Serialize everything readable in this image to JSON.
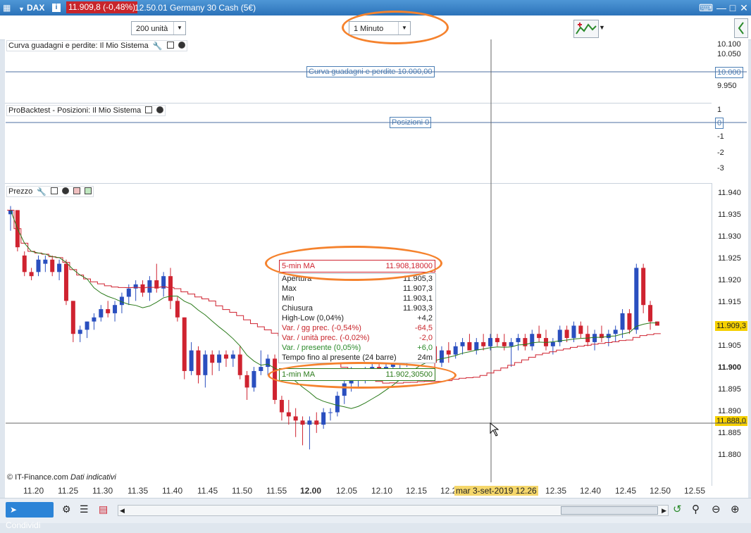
{
  "titlebar": {
    "symbol": "DAX",
    "price_change": "11.909,8 (-0,48%)",
    "time_instrument": "12.50.01 Germany 30 Cash (5€)"
  },
  "toolbar": {
    "units_select": "200 unità",
    "timeframe_select": "1 Minuto"
  },
  "panels": {
    "equity": {
      "title": "Curva guadagni e perdite: Il Mio Sistema",
      "value_label": "Curva guadagni e perdite   10.000,00",
      "axis": [
        "10.100",
        "10.050",
        "9.950"
      ],
      "axis_current": "10.000"
    },
    "positions": {
      "title": "ProBacktest - Posizioni: Il Mio Sistema",
      "value_label": "Posizioni   0",
      "axis": [
        "1",
        "-1",
        "-2",
        "-3"
      ],
      "axis_current": "0"
    },
    "price": {
      "title": "Prezzo",
      "axis": [
        "11.940",
        "11.935",
        "11.930",
        "11.925",
        "11.920",
        "11.915",
        "11.905",
        "11.900",
        "11.895",
        "11.890",
        "11.885",
        "11.880"
      ],
      "last_price": "11.909,3",
      "cursor_price": "11.888,0"
    }
  },
  "info_box": {
    "ma5_label": "5-min MA",
    "ma5_value": "11.908,18000",
    "rows": [
      {
        "label": "Apertura",
        "value": "11.905,3",
        "color": "#222222"
      },
      {
        "label": "Max",
        "value": "11.907,3",
        "color": "#222222"
      },
      {
        "label": "Min",
        "value": "11.903,1",
        "color": "#222222"
      },
      {
        "label": "Chiusura",
        "value": "11.903,3",
        "color": "#222222"
      },
      {
        "label": "High-Low (0,04%)",
        "value": "+4,2",
        "color": "#222222"
      },
      {
        "label": "Var. / gg prec. (-0,54%)",
        "value": "-64,5",
        "color": "#c8252b"
      },
      {
        "label": "Var. / unità prec. (-0,02%)",
        "value": "-2,0",
        "color": "#c8252b"
      },
      {
        "label": "Var. / presente (0,05%)",
        "value": "+6,0",
        "color": "#2a8a2a"
      },
      {
        "label": "Tempo fino al presente (24 barre)",
        "value": "24m",
        "color": "#222222"
      }
    ],
    "ma1_label": "1-min MA",
    "ma1_value": "11.902,30500"
  },
  "x_axis": [
    "11.20",
    "11.25",
    "11.30",
    "11.35",
    "11.40",
    "11.45",
    "11.50",
    "11.55",
    "12.00",
    "12.05",
    "12.10",
    "12.15",
    "12.2",
    "12.35",
    "12.40",
    "12.45",
    "12.50",
    "12.55"
  ],
  "cursor_time": "mar 3-set-2019 12.26",
  "credits": {
    "source": "© IT-Finance.com",
    "note": "Dati indicativi"
  },
  "bottom": {
    "share_label": "Condividi"
  },
  "colors": {
    "up": "#2a4fbf",
    "down": "#cf2330",
    "ma5": "#cf2330",
    "ma1": "#2a7a1a",
    "highlight": "#f5822d"
  },
  "chart_data": {
    "type": "candlestick",
    "x": [
      "11.17",
      "11.18",
      "11.19",
      "11.20",
      "11.21",
      "11.22",
      "11.23",
      "11.24",
      "11.25",
      "11.26",
      "11.27",
      "11.28",
      "11.29",
      "11.30",
      "11.31",
      "11.32",
      "11.33",
      "11.34",
      "11.35",
      "11.36",
      "11.37",
      "11.38",
      "11.39",
      "11.40",
      "11.41",
      "11.42",
      "11.43",
      "11.44",
      "11.45",
      "11.46",
      "11.47",
      "11.48",
      "11.49",
      "11.50",
      "11.51",
      "11.52",
      "11.53",
      "11.54",
      "11.55",
      "11.56",
      "11.57",
      "11.58",
      "11.59",
      "12.00",
      "12.01",
      "12.02",
      "12.03",
      "12.04",
      "12.05",
      "12.06",
      "12.07",
      "12.08",
      "12.09",
      "12.10",
      "12.11",
      "12.12",
      "12.13",
      "12.14",
      "12.15",
      "12.16",
      "12.17",
      "12.18",
      "12.19",
      "12.20",
      "12.21",
      "12.22",
      "12.23",
      "12.24",
      "12.25",
      "12.26",
      "12.27",
      "12.28",
      "12.29",
      "12.30",
      "12.31",
      "12.32",
      "12.33",
      "12.34",
      "12.35",
      "12.36",
      "12.37",
      "12.38",
      "12.39",
      "12.40",
      "12.41",
      "12.42",
      "12.43",
      "12.44",
      "12.45",
      "12.46",
      "12.47",
      "12.48",
      "12.49",
      "12.50"
    ],
    "ohlc": [
      [
        11936,
        11938,
        11932,
        11937
      ],
      [
        11937,
        11937,
        11927,
        11928
      ],
      [
        11926,
        11927,
        11921,
        11922
      ],
      [
        11922,
        11923,
        11920,
        11921
      ],
      [
        11922,
        11926,
        11921,
        11925
      ],
      [
        11924,
        11926,
        11922,
        11925
      ],
      [
        11925,
        11926,
        11921,
        11922
      ],
      [
        11922,
        11925,
        11920,
        11924
      ],
      [
        11924,
        11925,
        11914,
        11915
      ],
      [
        11915,
        11915,
        11905,
        11907
      ],
      [
        11907,
        11909,
        11905,
        11908
      ],
      [
        11908,
        11910,
        11906,
        11910
      ],
      [
        11910,
        11912,
        11908,
        11911
      ],
      [
        11911,
        11914,
        11910,
        11913
      ],
      [
        11913,
        11915,
        11911,
        11912
      ],
      [
        11912,
        11915,
        11910,
        11914
      ],
      [
        11914,
        11917,
        11912,
        11916
      ],
      [
        11916,
        11919,
        11914,
        11918
      ],
      [
        11918,
        11920,
        11915,
        11919
      ],
      [
        11919,
        11920,
        11916,
        11917
      ],
      [
        11917,
        11921,
        11915,
        11920
      ],
      [
        11920,
        11924,
        11917,
        11918
      ],
      [
        11918,
        11922,
        11916,
        11921
      ],
      [
        11921,
        11923,
        11913,
        11915
      ],
      [
        11915,
        11916,
        11910,
        11911
      ],
      [
        11911,
        11911,
        11896,
        11898
      ],
      [
        11898,
        11905,
        11897,
        11903
      ],
      [
        11903,
        11904,
        11895,
        11897
      ],
      [
        11897,
        11903,
        11894,
        11902
      ],
      [
        11902,
        11903,
        11897,
        11900
      ],
      [
        11900,
        11903,
        11898,
        11902
      ],
      [
        11902,
        11903,
        11899,
        11901
      ],
      [
        11901,
        11903,
        11899,
        11902
      ],
      [
        11902,
        11904,
        11896,
        11897
      ],
      [
        11897,
        11898,
        11891,
        11894
      ],
      [
        11894,
        11899,
        11893,
        11898
      ],
      [
        11898,
        11903,
        11897,
        11899
      ],
      [
        11899,
        11902,
        11897,
        11901
      ],
      [
        11901,
        11902,
        11890,
        11891
      ],
      [
        11891,
        11892,
        11886,
        11888
      ],
      [
        11888,
        11891,
        11885,
        11887
      ],
      [
        11887,
        11889,
        11882,
        11886
      ],
      [
        11886,
        11887,
        11880,
        11885
      ],
      [
        11885,
        11887,
        11879,
        11886
      ],
      [
        11886,
        11888,
        11883,
        11885
      ],
      [
        11885,
        11889,
        11884,
        11888
      ],
      [
        11888,
        11889,
        11886,
        11888
      ],
      [
        11888,
        11893,
        11887,
        11892
      ],
      [
        11892,
        11896,
        11890,
        11895
      ],
      [
        11895,
        11899,
        11893,
        11896
      ],
      [
        11896,
        11898,
        11894,
        11897
      ],
      [
        11897,
        11899,
        11895,
        11898
      ],
      [
        11898,
        11900,
        11896,
        11899
      ],
      [
        11899,
        11901,
        11897,
        11898
      ],
      [
        11898,
        11900,
        11896,
        11899
      ],
      [
        11899,
        11901,
        11897,
        11900
      ],
      [
        11900,
        11902,
        11898,
        11901
      ],
      [
        11901,
        11903,
        11899,
        11902
      ],
      [
        11902,
        11904,
        11900,
        11903
      ],
      [
        11903,
        11906,
        11901,
        11905
      ],
      [
        11905,
        11908,
        11902,
        11904
      ],
      [
        11904,
        11906,
        11898,
        11900
      ],
      [
        11900,
        11904,
        11899,
        11903
      ],
      [
        11903,
        11905,
        11900,
        11902
      ],
      [
        11902,
        11905,
        11901,
        11904
      ],
      [
        11904,
        11906,
        11902,
        11905
      ],
      [
        11905,
        11907,
        11903,
        11903
      ],
      [
        11903,
        11906,
        11902,
        11905
      ],
      [
        11905,
        11907,
        11903,
        11904
      ],
      [
        11904,
        11907,
        11903,
        11906
      ],
      [
        11906,
        11907,
        11904,
        11905
      ],
      [
        11905,
        11907,
        11903,
        11904
      ],
      [
        11904,
        11906,
        11899,
        11905
      ],
      [
        11905,
        11907,
        11903,
        11906
      ],
      [
        11906,
        11907,
        11903,
        11904
      ],
      [
        11904,
        11908,
        11903,
        11907
      ],
      [
        11907,
        11909,
        11905,
        11906
      ],
      [
        11906,
        11908,
        11903,
        11904
      ],
      [
        11904,
        11906,
        11902,
        11905
      ],
      [
        11905,
        11909,
        11904,
        11908
      ],
      [
        11908,
        11909,
        11905,
        11906
      ],
      [
        11906,
        11910,
        11905,
        11909
      ],
      [
        11909,
        11910,
        11906,
        11907
      ],
      [
        11907,
        11909,
        11904,
        11905
      ],
      [
        11905,
        11908,
        11903,
        11907
      ],
      [
        11907,
        11909,
        11905,
        11906
      ],
      [
        11906,
        11908,
        11904,
        11907
      ],
      [
        11907,
        11909,
        11905,
        11908
      ],
      [
        11908,
        11913,
        11906,
        11912
      ],
      [
        11912,
        11913,
        11907,
        11908
      ],
      [
        11908,
        11924,
        11907,
        11923
      ],
      [
        11923,
        11924,
        11912,
        11914
      ],
      [
        11914,
        11915,
        11908,
        11910
      ],
      [
        11910,
        11910,
        11909,
        11909
      ]
    ],
    "ylim": [
      11877,
      11941
    ]
  }
}
